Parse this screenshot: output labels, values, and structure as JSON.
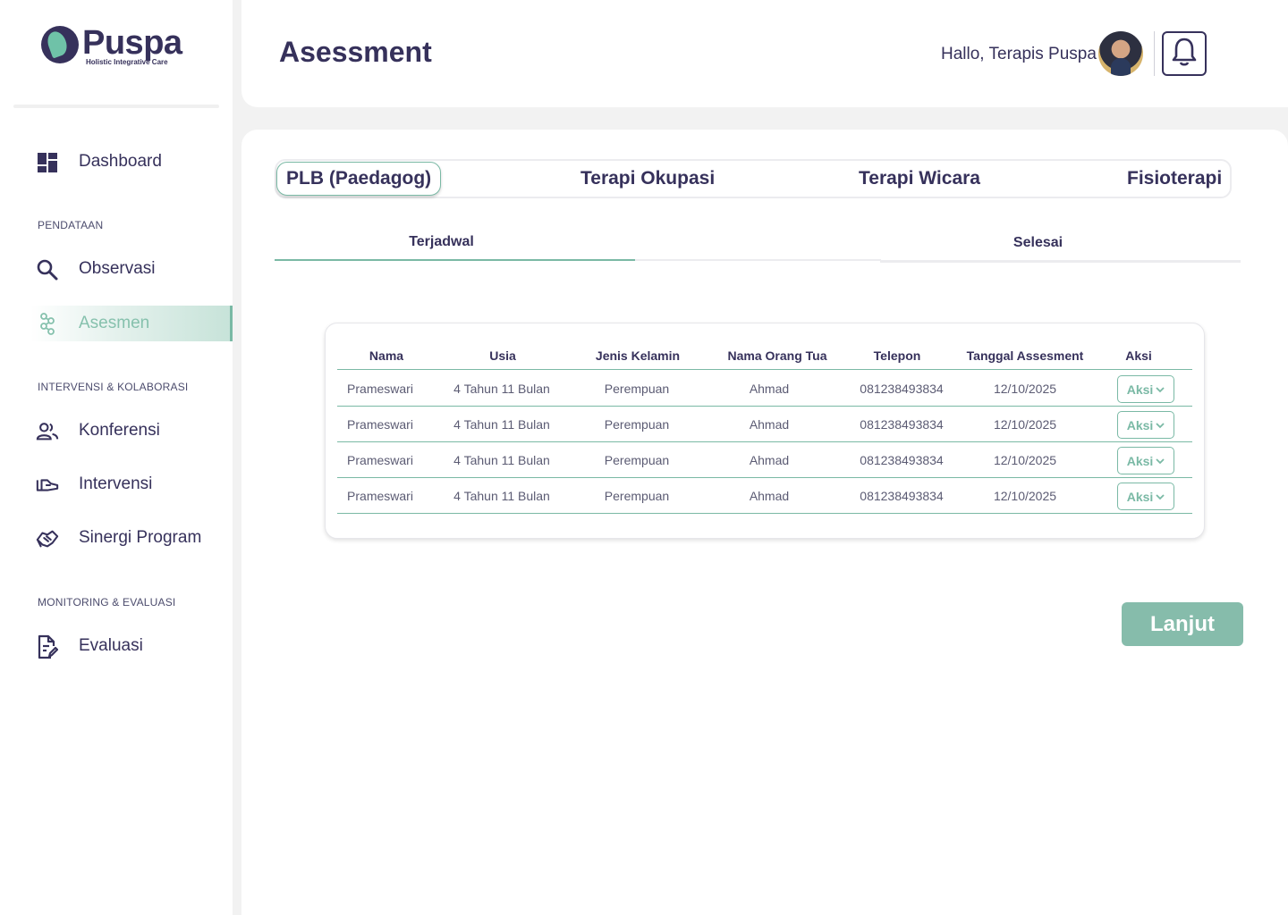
{
  "brand": {
    "name": "Puspa",
    "tagline": "Holistic Integrative Care",
    "accent": "#7ab9a5",
    "primary": "#36315b"
  },
  "sidebar": {
    "dashboard": {
      "label": "Dashboard",
      "icon": "dashboard-icon"
    },
    "sections": [
      {
        "title": "PENDATAAN"
      },
      {
        "title": "INTERVENSI & KOLABORASI"
      },
      {
        "title": "MONITORING & EVALUASI"
      }
    ],
    "items": [
      {
        "label": "Observasi",
        "icon": "search-icon"
      },
      {
        "label": "Asesmen",
        "icon": "asesmen-icon",
        "active": true
      },
      {
        "label": "Konferensi",
        "icon": "people-icon"
      },
      {
        "label": "Intervensi",
        "icon": "hand-icon"
      },
      {
        "label": "Sinergi Program",
        "icon": "handshake-icon"
      },
      {
        "label": "Evaluasi",
        "icon": "document-edit-icon"
      }
    ]
  },
  "header": {
    "title": "Asessment",
    "greeting": "Hallo, Terapis Puspa"
  },
  "tabs": [
    {
      "label": "PLB (Paedagog)",
      "active": true
    },
    {
      "label": "Terapi Okupasi"
    },
    {
      "label": "Terapi Wicara"
    },
    {
      "label": "Fisioterapi"
    }
  ],
  "subtabs": [
    {
      "label": "Terjadwal",
      "active": true
    },
    {
      "label": "Selesai"
    }
  ],
  "table": {
    "columns": [
      "Nama",
      "Usia",
      "Jenis Kelamin",
      "Nama Orang Tua",
      "Telepon",
      "Tanggal Assesment",
      "Aksi"
    ],
    "rows": [
      {
        "nama": "Prameswari",
        "usia": "4 Tahun 11 Bulan",
        "jk": "Perempuan",
        "ortu": "Ahmad",
        "telepon": "081238493834",
        "tanggal": "12/10/2025",
        "aksi": "Aksi"
      },
      {
        "nama": "Prameswari",
        "usia": "4 Tahun 11 Bulan",
        "jk": "Perempuan",
        "ortu": "Ahmad",
        "telepon": "081238493834",
        "tanggal": "12/10/2025",
        "aksi": "Aksi"
      },
      {
        "nama": "Prameswari",
        "usia": "4 Tahun 11 Bulan",
        "jk": "Perempuan",
        "ortu": "Ahmad",
        "telepon": "081238493834",
        "tanggal": "12/10/2025",
        "aksi": "Aksi"
      },
      {
        "nama": "Prameswari",
        "usia": "4 Tahun 11 Bulan",
        "jk": "Perempuan",
        "ortu": "Ahmad",
        "telepon": "081238493834",
        "tanggal": "12/10/2025",
        "aksi": "Aksi"
      }
    ]
  },
  "actions": {
    "next_label": "Lanjut"
  }
}
